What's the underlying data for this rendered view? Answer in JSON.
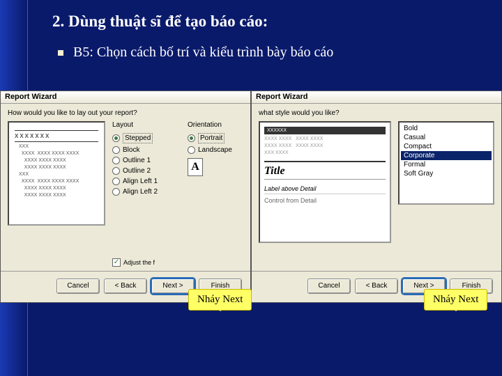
{
  "heading": "2. Dùng thuật sĩ để tạo báo cáo:",
  "step_text": "B5: Chọn cách bố trí và kiểu trình bày báo cáo",
  "wizard_title": "Report Wizard",
  "left": {
    "question": "How would you like to lay out your report?",
    "layout_label": "Layout",
    "orientation_label": "Orientation",
    "layouts": [
      {
        "label": "Stepped",
        "checked": true
      },
      {
        "label": "Block",
        "checked": false
      },
      {
        "label": "Outline 1",
        "checked": false
      },
      {
        "label": "Outline 2",
        "checked": false
      },
      {
        "label": "Align Left 1",
        "checked": false
      },
      {
        "label": "Align Left 2",
        "checked": false
      }
    ],
    "orientations": [
      {
        "label": "Portrait",
        "checked": true
      },
      {
        "label": "Landscape",
        "checked": false
      }
    ],
    "orient_glyph": "A",
    "adjust_label": "Adjust the f",
    "adjust_checked": "✓",
    "preview_header": "XXXXXXX"
  },
  "right": {
    "question": "what style would you like?",
    "styles": [
      "Bold",
      "Casual",
      "Compact",
      "Corporate",
      "Formal",
      "Soft Gray"
    ],
    "selected_index": 3,
    "preview_band": "XXXXXX",
    "preview_title": "Title",
    "preview_label": "Label above Detail",
    "preview_control": "Control from Detail"
  },
  "buttons": {
    "cancel": "Cancel",
    "back": "< Back",
    "next": "Next >",
    "finish": "Finish"
  },
  "callout": "Nháy Next"
}
